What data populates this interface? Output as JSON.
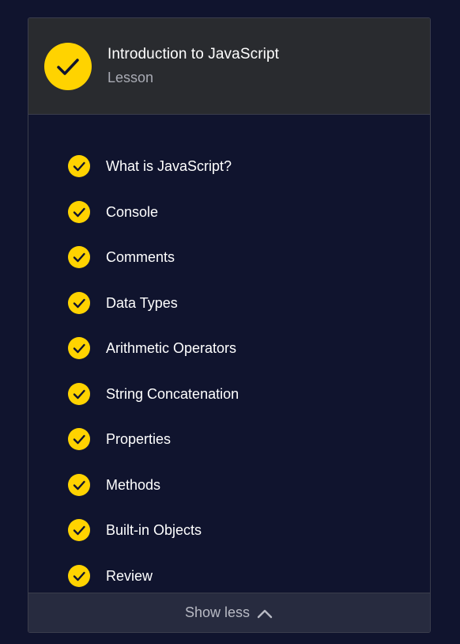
{
  "colors": {
    "background": "#10142e",
    "header_background": "#292b2f",
    "check_yellow": "#ffd300",
    "footer_background": "#272b3f"
  },
  "header": {
    "icon": "check-circle-icon",
    "title": "Introduction to JavaScript",
    "subtitle": "Lesson"
  },
  "items": [
    {
      "label": "What is JavaScript?",
      "icon": "check-circle-icon"
    },
    {
      "label": "Console",
      "icon": "check-circle-icon"
    },
    {
      "label": "Comments",
      "icon": "check-circle-icon"
    },
    {
      "label": "Data Types",
      "icon": "check-circle-icon"
    },
    {
      "label": "Arithmetic Operators",
      "icon": "check-circle-icon"
    },
    {
      "label": "String Concatenation",
      "icon": "check-circle-icon"
    },
    {
      "label": "Properties",
      "icon": "check-circle-icon"
    },
    {
      "label": "Methods",
      "icon": "check-circle-icon"
    },
    {
      "label": "Built-in Objects",
      "icon": "check-circle-icon"
    },
    {
      "label": "Review",
      "icon": "check-circle-icon"
    }
  ],
  "footer": {
    "toggle_label": "Show less",
    "icon": "chevron-up-icon"
  }
}
